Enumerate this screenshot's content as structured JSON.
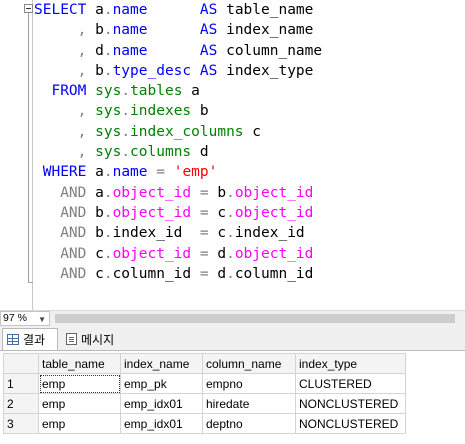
{
  "editor": {
    "lines": [
      [
        [
          "kw",
          "SELECT "
        ],
        [
          "plain",
          "a"
        ],
        [
          "op",
          "."
        ],
        [
          "kw",
          "name"
        ],
        [
          "plain",
          "      "
        ],
        [
          "kw",
          "AS "
        ],
        [
          "plain",
          "table_name"
        ]
      ],
      [
        [
          "op",
          "     , "
        ],
        [
          "plain",
          "b"
        ],
        [
          "op",
          "."
        ],
        [
          "kw",
          "name"
        ],
        [
          "plain",
          "      "
        ],
        [
          "kw",
          "AS "
        ],
        [
          "plain",
          "index_name"
        ]
      ],
      [
        [
          "op",
          "     , "
        ],
        [
          "plain",
          "d"
        ],
        [
          "op",
          "."
        ],
        [
          "kw",
          "name"
        ],
        [
          "plain",
          "      "
        ],
        [
          "kw",
          "AS "
        ],
        [
          "plain",
          "column_name"
        ]
      ],
      [
        [
          "op",
          "     , "
        ],
        [
          "plain",
          "b"
        ],
        [
          "op",
          "."
        ],
        [
          "kw",
          "type_desc"
        ],
        [
          "plain",
          " "
        ],
        [
          "kw",
          "AS "
        ],
        [
          "plain",
          "index_type"
        ]
      ],
      [
        [
          "plain",
          "  "
        ],
        [
          "kw",
          "FROM "
        ],
        [
          "sys",
          "sys"
        ],
        [
          "op",
          "."
        ],
        [
          "sys",
          "tables"
        ],
        [
          "plain",
          " a"
        ]
      ],
      [
        [
          "op",
          "     , "
        ],
        [
          "sys",
          "sys"
        ],
        [
          "op",
          "."
        ],
        [
          "sys",
          "indexes"
        ],
        [
          "plain",
          " b"
        ]
      ],
      [
        [
          "op",
          "     , "
        ],
        [
          "sys",
          "sys"
        ],
        [
          "op",
          "."
        ],
        [
          "sys",
          "index_columns"
        ],
        [
          "plain",
          " c"
        ]
      ],
      [
        [
          "op",
          "     , "
        ],
        [
          "sys",
          "sys"
        ],
        [
          "op",
          "."
        ],
        [
          "sys",
          "columns"
        ],
        [
          "plain",
          " d"
        ]
      ],
      [
        [
          "plain",
          " "
        ],
        [
          "kw",
          "WHERE "
        ],
        [
          "plain",
          "a"
        ],
        [
          "op",
          "."
        ],
        [
          "kw",
          "name"
        ],
        [
          "plain",
          " "
        ],
        [
          "op",
          "= "
        ],
        [
          "str",
          "'emp'"
        ]
      ],
      [
        [
          "op",
          "   AND "
        ],
        [
          "plain",
          "a"
        ],
        [
          "op",
          "."
        ],
        [
          "fn",
          "object_id"
        ],
        [
          "plain",
          " "
        ],
        [
          "op",
          "= "
        ],
        [
          "plain",
          "b"
        ],
        [
          "op",
          "."
        ],
        [
          "fn",
          "object_id"
        ]
      ],
      [
        [
          "op",
          "   AND "
        ],
        [
          "plain",
          "b"
        ],
        [
          "op",
          "."
        ],
        [
          "fn",
          "object_id"
        ],
        [
          "plain",
          " "
        ],
        [
          "op",
          "= "
        ],
        [
          "plain",
          "c"
        ],
        [
          "op",
          "."
        ],
        [
          "fn",
          "object_id"
        ]
      ],
      [
        [
          "op",
          "   AND "
        ],
        [
          "plain",
          "b"
        ],
        [
          "op",
          "."
        ],
        [
          "plain",
          "index_id  "
        ],
        [
          "op",
          "= "
        ],
        [
          "plain",
          "c"
        ],
        [
          "op",
          "."
        ],
        [
          "plain",
          "index_id"
        ]
      ],
      [
        [
          "op",
          "   AND "
        ],
        [
          "plain",
          "c"
        ],
        [
          "op",
          "."
        ],
        [
          "fn",
          "object_id"
        ],
        [
          "plain",
          " "
        ],
        [
          "op",
          "= "
        ],
        [
          "plain",
          "d"
        ],
        [
          "op",
          "."
        ],
        [
          "fn",
          "object_id"
        ]
      ],
      [
        [
          "op",
          "   AND "
        ],
        [
          "plain",
          "c"
        ],
        [
          "op",
          "."
        ],
        [
          "plain",
          "column_id "
        ],
        [
          "op",
          "= "
        ],
        [
          "plain",
          "d"
        ],
        [
          "op",
          "."
        ],
        [
          "plain",
          "column_id"
        ]
      ]
    ]
  },
  "zoom": {
    "value": "97 %"
  },
  "tabs": {
    "results_label": "결과",
    "messages_label": "메시지"
  },
  "results": {
    "columns": [
      "table_name",
      "index_name",
      "column_name",
      "index_type"
    ],
    "rows": [
      [
        "1",
        "emp",
        "emp_pk",
        "empno",
        "CLUSTERED"
      ],
      [
        "2",
        "emp",
        "emp_idx01",
        "hiredate",
        "NONCLUSTERED"
      ],
      [
        "3",
        "emp",
        "emp_idx01",
        "deptno",
        "NONCLUSTERED"
      ]
    ]
  },
  "colors": {
    "keyword": "#0000ff",
    "system": "#008000",
    "function": "#ff00ff",
    "string": "#ff0000",
    "operator": "#808080"
  }
}
